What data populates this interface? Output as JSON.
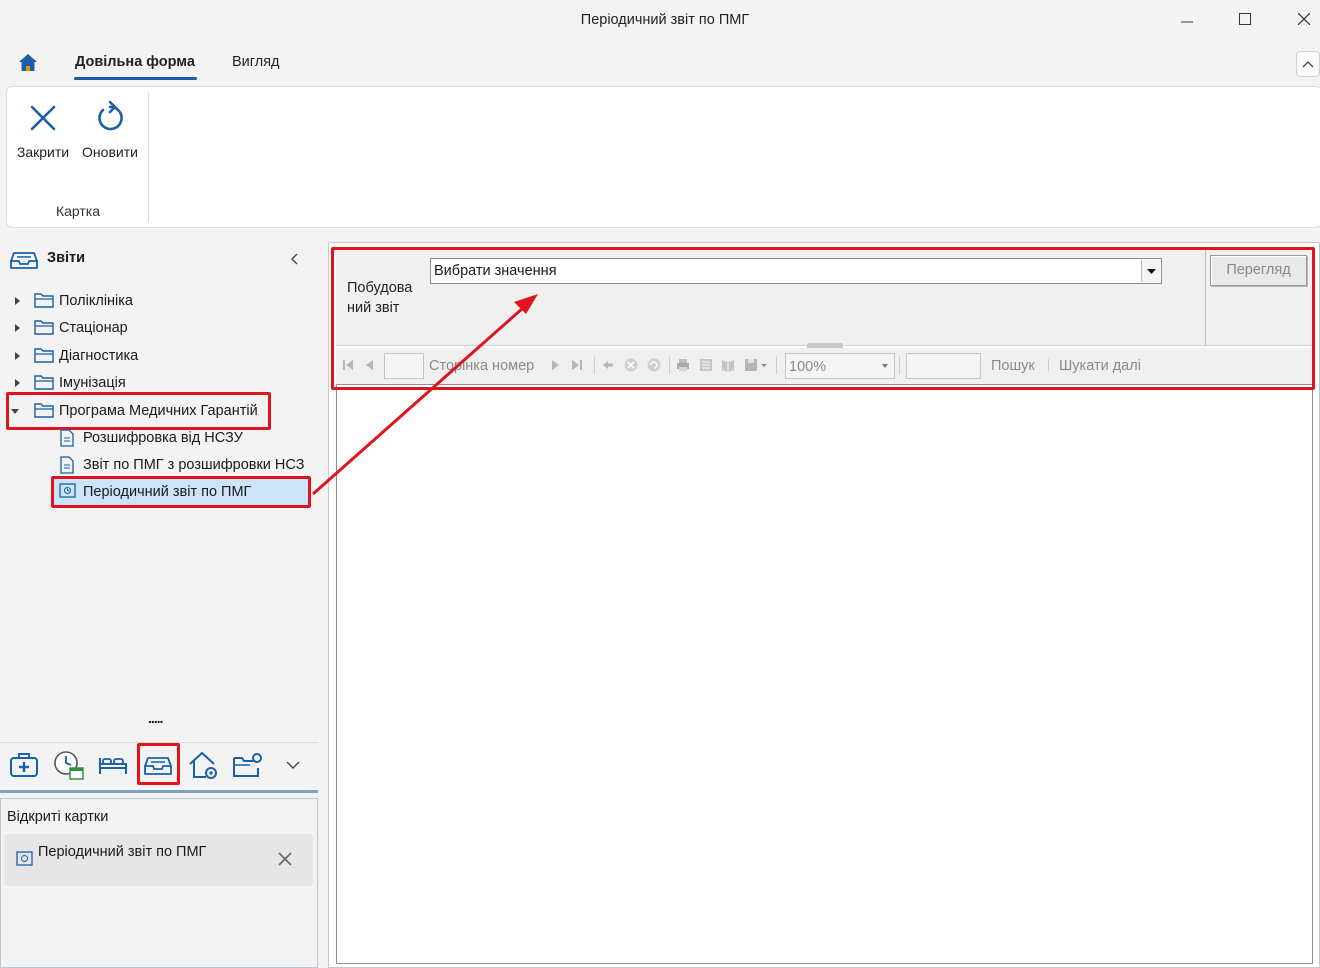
{
  "window": {
    "title": "Періодичний звіт по ПМГ"
  },
  "ribbon": {
    "tabs": [
      {
        "label": "Довільна форма",
        "active": true
      },
      {
        "label": "Вигляд",
        "active": false
      }
    ],
    "buttons": {
      "close_label": "Закрити",
      "refresh_label": "Оновити"
    },
    "group_label": "Картка"
  },
  "tree": {
    "header_label": "Звіти",
    "folders": [
      {
        "label": "Поліклініка"
      },
      {
        "label": "Стаціонар"
      },
      {
        "label": "Діагностика"
      },
      {
        "label": "Імунізація"
      },
      {
        "label": "Програма Медичних Гарантій"
      }
    ],
    "pmg_children": [
      {
        "label": "Розшифровка від НСЗУ"
      },
      {
        "label": "Звіт по ПМГ з розшифровки НСЗ"
      },
      {
        "label": "Періодичний звіт по ПМГ",
        "selected": true
      }
    ],
    "splitter_dots": "....."
  },
  "nav_bar": {
    "icons": [
      "first-aid-kit-icon",
      "clock-calendar-icon",
      "bed-icon",
      "reports-tray-icon",
      "home-settings-icon",
      "folder-settings-icon",
      "chevron-down-icon"
    ],
    "active_icon": "reports-tray-icon"
  },
  "open_cards": {
    "title": "Відкриті картки",
    "items": [
      {
        "label": "Періодичний звіт по ПМГ"
      }
    ]
  },
  "report": {
    "param_label": "Побудова ний звіт",
    "select_placeholder": "Вибрати значення",
    "view_button_label": "Перегляд",
    "toolbar": {
      "page_number_label": "Сторінка номер",
      "zoom_value": "100%",
      "search_label": "Пошук",
      "find_next_label": "Шукати далі"
    }
  },
  "colors": {
    "accent": "#1a5fa8",
    "highlight_red": "#e0141e",
    "selection_bg": "#cce4f7"
  }
}
